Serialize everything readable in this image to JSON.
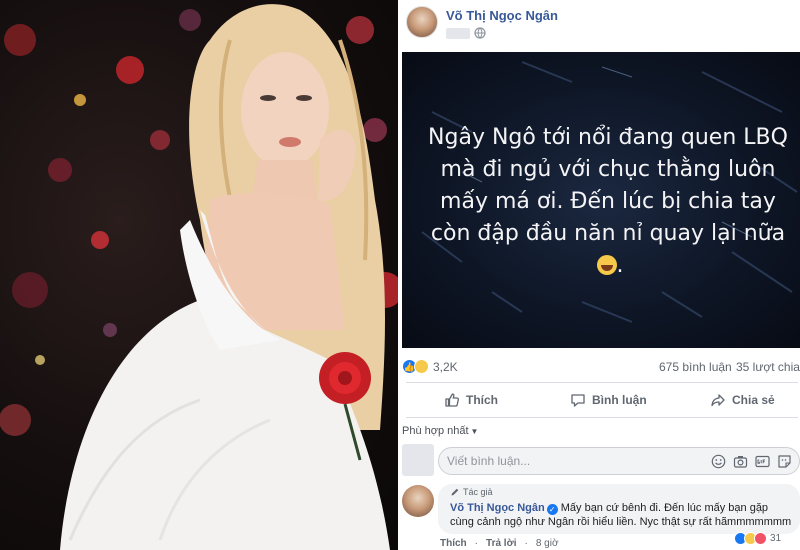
{
  "post": {
    "author_name": "Võ Thị Ngọc Ngân",
    "card_text": "Ngây Ngô tới nổi đang quen LBQ mà đi ngủ với chục thằng luôn mấy má ơi. Đến lúc bị chia tay còn đập đầu năn nỉ quay lại nữa",
    "reactions_count": "3,2K",
    "comments_count": "675 bình luận",
    "shares_count": "35 lượt chia sẻ",
    "actions": {
      "like": "Thích",
      "comment": "Bình luận",
      "share": "Chia sẻ"
    },
    "sort_label": "Phù hợp nhất",
    "composer_placeholder": "Viết bình luận...",
    "icons": {
      "visibility": "globe-icon",
      "like": "thumbs-up-icon",
      "comment": "speech-bubble-icon",
      "share": "share-arrow-icon",
      "emoji": "smiley-icon",
      "camera": "camera-icon",
      "gif": "gif-icon",
      "sticker": "sticker-icon"
    },
    "colors": {
      "name_link": "#385898",
      "like_blue": "#1877f2",
      "card_bg": "#0e1626"
    }
  },
  "top_comment": {
    "tag": "Tác giả",
    "author_name": "Võ Thị Ngọc Ngân",
    "text": "Mấy bạn cứ bênh đi. Đến lúc mấy bạn gặp cùng cảnh ngộ như Ngân rồi hiểu liền. Nyc thật sự rất hãmmmmmmm",
    "like_label": "Thích",
    "reply_label": "Trả lời",
    "time": "8 giờ",
    "reactions_count": "31"
  }
}
